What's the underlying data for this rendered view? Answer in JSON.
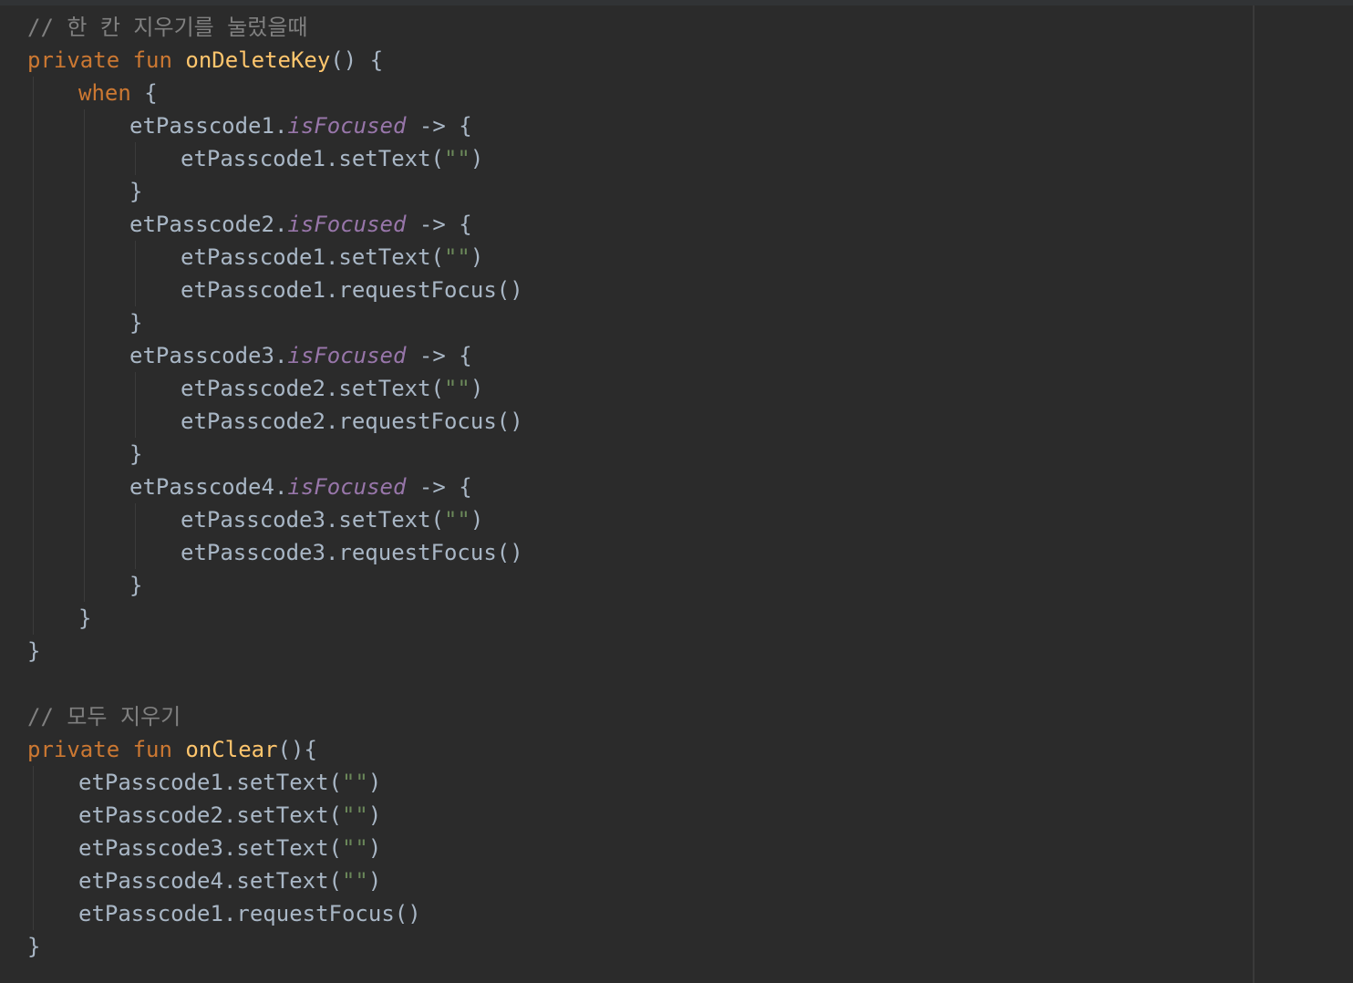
{
  "editor": {
    "language": "kotlin",
    "colors": {
      "background": "#2b2b2b",
      "keyword": "#cc7832",
      "function": "#ffc66d",
      "property": "#9876aa",
      "comment": "#808080",
      "string": "#6a8759",
      "plain": "#a9b7c6"
    },
    "lines": [
      {
        "indent": 0,
        "tokens": [
          {
            "t": "com",
            "v": "// 한 칸 지우기를 눌렀을때"
          }
        ]
      },
      {
        "indent": 0,
        "tokens": [
          {
            "t": "kw",
            "v": "private fun "
          },
          {
            "t": "fn",
            "v": "onDeleteKey"
          },
          {
            "t": "plain",
            "v": "() {"
          }
        ]
      },
      {
        "indent": 1,
        "tokens": [
          {
            "t": "kw",
            "v": "when"
          },
          {
            "t": "plain",
            "v": " {"
          }
        ]
      },
      {
        "indent": 2,
        "tokens": [
          {
            "t": "plain",
            "v": "etPasscode1."
          },
          {
            "t": "prop",
            "v": "isFocused"
          },
          {
            "t": "plain",
            "v": " -> {"
          }
        ]
      },
      {
        "indent": 3,
        "tokens": [
          {
            "t": "plain",
            "v": "etPasscode1.setText("
          },
          {
            "t": "str",
            "v": "\"\""
          },
          {
            "t": "plain",
            "v": ")"
          }
        ]
      },
      {
        "indent": 2,
        "tokens": [
          {
            "t": "plain",
            "v": "}"
          }
        ]
      },
      {
        "indent": 2,
        "tokens": [
          {
            "t": "plain",
            "v": "etPasscode2."
          },
          {
            "t": "prop",
            "v": "isFocused"
          },
          {
            "t": "plain",
            "v": " -> {"
          }
        ]
      },
      {
        "indent": 3,
        "tokens": [
          {
            "t": "plain",
            "v": "etPasscode1.setText("
          },
          {
            "t": "str",
            "v": "\"\""
          },
          {
            "t": "plain",
            "v": ")"
          }
        ]
      },
      {
        "indent": 3,
        "tokens": [
          {
            "t": "plain",
            "v": "etPasscode1.requestFocus()"
          }
        ]
      },
      {
        "indent": 2,
        "tokens": [
          {
            "t": "plain",
            "v": "}"
          }
        ]
      },
      {
        "indent": 2,
        "tokens": [
          {
            "t": "plain",
            "v": "etPasscode3."
          },
          {
            "t": "prop",
            "v": "isFocused"
          },
          {
            "t": "plain",
            "v": " -> {"
          }
        ]
      },
      {
        "indent": 3,
        "tokens": [
          {
            "t": "plain",
            "v": "etPasscode2.setText("
          },
          {
            "t": "str",
            "v": "\"\""
          },
          {
            "t": "plain",
            "v": ")"
          }
        ]
      },
      {
        "indent": 3,
        "tokens": [
          {
            "t": "plain",
            "v": "etPasscode2.requestFocus()"
          }
        ]
      },
      {
        "indent": 2,
        "tokens": [
          {
            "t": "plain",
            "v": "}"
          }
        ]
      },
      {
        "indent": 2,
        "tokens": [
          {
            "t": "plain",
            "v": "etPasscode4."
          },
          {
            "t": "prop",
            "v": "isFocused"
          },
          {
            "t": "plain",
            "v": " -> {"
          }
        ]
      },
      {
        "indent": 3,
        "tokens": [
          {
            "t": "plain",
            "v": "etPasscode3.setText("
          },
          {
            "t": "str",
            "v": "\"\""
          },
          {
            "t": "plain",
            "v": ")"
          }
        ]
      },
      {
        "indent": 3,
        "tokens": [
          {
            "t": "plain",
            "v": "etPasscode3.requestFocus()"
          }
        ]
      },
      {
        "indent": 2,
        "tokens": [
          {
            "t": "plain",
            "v": "}"
          }
        ]
      },
      {
        "indent": 1,
        "tokens": [
          {
            "t": "plain",
            "v": "}"
          }
        ]
      },
      {
        "indent": 0,
        "tokens": [
          {
            "t": "plain",
            "v": "}"
          }
        ]
      },
      {
        "indent": 0,
        "tokens": []
      },
      {
        "indent": 0,
        "tokens": [
          {
            "t": "com",
            "v": "// 모두 지우기"
          }
        ]
      },
      {
        "indent": 0,
        "tokens": [
          {
            "t": "kw",
            "v": "private fun "
          },
          {
            "t": "fn",
            "v": "onClear"
          },
          {
            "t": "plain",
            "v": "(){"
          }
        ]
      },
      {
        "indent": 1,
        "tokens": [
          {
            "t": "plain",
            "v": "etPasscode1.setText("
          },
          {
            "t": "str",
            "v": "\"\""
          },
          {
            "t": "plain",
            "v": ")"
          }
        ]
      },
      {
        "indent": 1,
        "tokens": [
          {
            "t": "plain",
            "v": "etPasscode2.setText("
          },
          {
            "t": "str",
            "v": "\"\""
          },
          {
            "t": "plain",
            "v": ")"
          }
        ]
      },
      {
        "indent": 1,
        "tokens": [
          {
            "t": "plain",
            "v": "etPasscode3.setText("
          },
          {
            "t": "str",
            "v": "\"\""
          },
          {
            "t": "plain",
            "v": ")"
          }
        ]
      },
      {
        "indent": 1,
        "tokens": [
          {
            "t": "plain",
            "v": "etPasscode4.setText("
          },
          {
            "t": "str",
            "v": "\"\""
          },
          {
            "t": "plain",
            "v": ")"
          }
        ]
      },
      {
        "indent": 1,
        "tokens": [
          {
            "t": "plain",
            "v": "etPasscode1.requestFocus()"
          }
        ]
      },
      {
        "indent": 0,
        "tokens": [
          {
            "t": "plain",
            "v": "}"
          }
        ]
      }
    ]
  }
}
